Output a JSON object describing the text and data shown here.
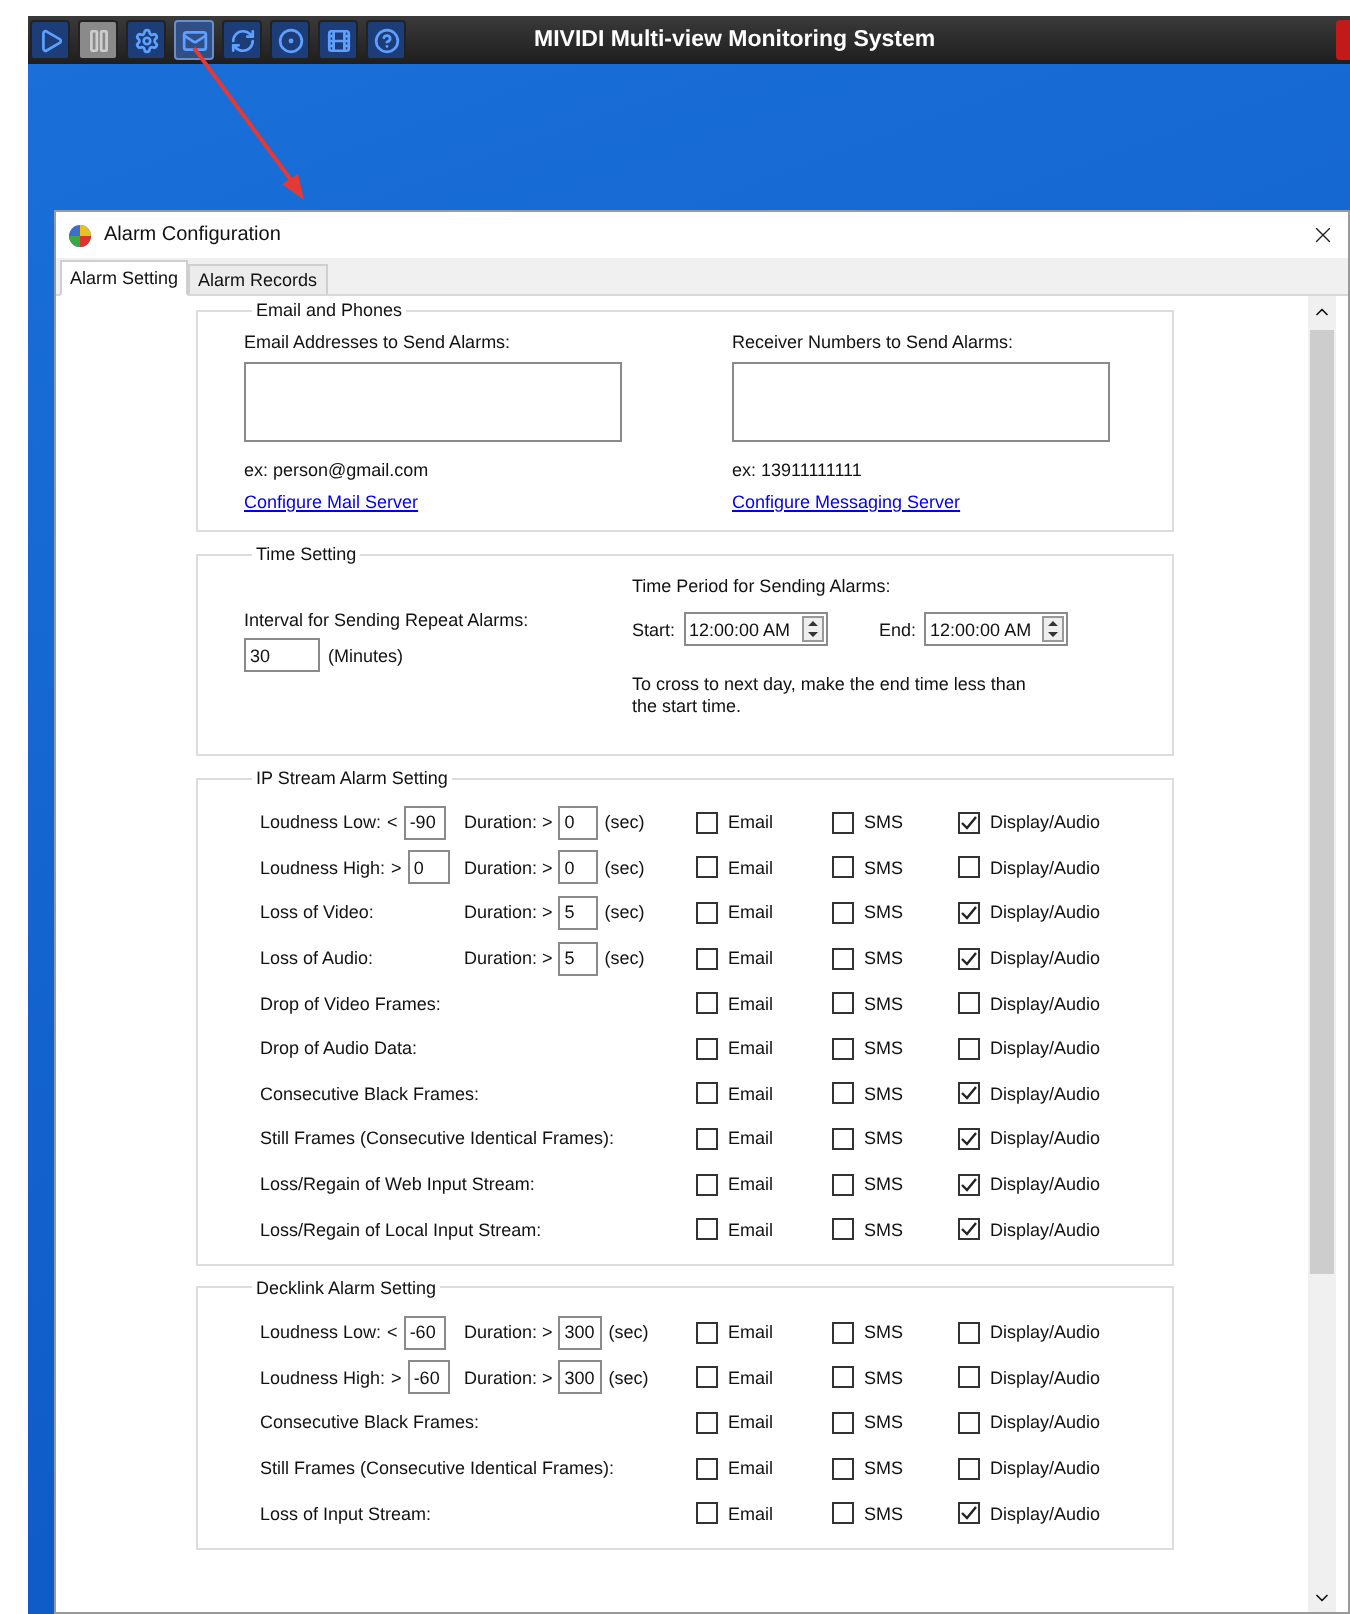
{
  "app": {
    "title": "MIVIDI Multi-view Monitoring System",
    "toolbar": [
      {
        "kind": "play",
        "disabled": false,
        "selected": false
      },
      {
        "kind": "pause",
        "disabled": true,
        "selected": false
      },
      {
        "kind": "settings",
        "disabled": false,
        "selected": false
      },
      {
        "kind": "mail",
        "disabled": false,
        "selected": true
      },
      {
        "kind": "refresh",
        "disabled": false,
        "selected": false
      },
      {
        "kind": "record",
        "disabled": false,
        "selected": false
      },
      {
        "kind": "filmstrip",
        "disabled": false,
        "selected": false
      },
      {
        "kind": "help",
        "disabled": false,
        "selected": false
      }
    ]
  },
  "dialog": {
    "title": "Alarm Configuration",
    "tabs": [
      {
        "label": "Alarm Setting",
        "selected": true
      },
      {
        "label": "Alarm Records",
        "selected": false
      }
    ]
  },
  "email_and_phones": {
    "title": "Email and Phones",
    "columns": [
      {
        "label": "Email Addresses to Send Alarms:",
        "example": "ex: person@gmail.com",
        "link": "Configure Mail Server"
      },
      {
        "label": "Receiver Numbers to Send Alarms:",
        "example": "ex: 13911111111",
        "link": "Configure Messaging Server"
      }
    ]
  },
  "time_setting": {
    "title": "Time Setting",
    "interval_label": "Interval for Sending Repeat Alarms:",
    "interval_value": "30",
    "interval_unit": "(Minutes)",
    "period_label": "Time Period for Sending Alarms:",
    "start_label": "Start:",
    "start": "12:00:00 AM",
    "end_label": "End:",
    "end": "12:00:00 AM",
    "note": "To cross to next day, make the end time less than the start time."
  },
  "ip_stream": {
    "title": "IP Stream Alarm Setting",
    "rows": [
      {
        "kind": "threshold",
        "label": "Loudness Low:",
        "operator": "<",
        "value": "-90",
        "duration_label": "Duration: >",
        "duration": "0",
        "unit": "(sec)",
        "options": [
          {
            "label": "Email",
            "checked": false
          },
          {
            "label": "SMS",
            "checked": false
          },
          {
            "label": "Display/Audio",
            "checked": true
          }
        ]
      },
      {
        "kind": "threshold",
        "label": "Loudness High:",
        "operator": ">",
        "value": "0",
        "duration_label": "Duration: >",
        "duration": "0",
        "unit": "(sec)",
        "options": [
          {
            "label": "Email",
            "checked": false
          },
          {
            "label": "SMS",
            "checked": false
          },
          {
            "label": "Display/Audio",
            "checked": false
          }
        ]
      },
      {
        "kind": "duration",
        "label": "Loss of Video:",
        "duration_label": "Duration: >",
        "duration": "5",
        "unit": "(sec)",
        "options": [
          {
            "label": "Email",
            "checked": false
          },
          {
            "label": "SMS",
            "checked": false
          },
          {
            "label": "Display/Audio",
            "checked": true
          }
        ]
      },
      {
        "kind": "duration",
        "label": "Loss of Audio:",
        "duration_label": "Duration: >",
        "duration": "5",
        "unit": "(sec)",
        "options": [
          {
            "label": "Email",
            "checked": false
          },
          {
            "label": "SMS",
            "checked": false
          },
          {
            "label": "Display/Audio",
            "checked": true
          }
        ]
      },
      {
        "kind": "plain",
        "label": "Drop of Video Frames:",
        "options": [
          {
            "label": "Email",
            "checked": false
          },
          {
            "label": "SMS",
            "checked": false
          },
          {
            "label": "Display/Audio",
            "checked": false
          }
        ]
      },
      {
        "kind": "plain",
        "label": "Drop of Audio Data:",
        "options": [
          {
            "label": "Email",
            "checked": false
          },
          {
            "label": "SMS",
            "checked": false
          },
          {
            "label": "Display/Audio",
            "checked": false
          }
        ]
      },
      {
        "kind": "plain",
        "label": "Consecutive Black Frames:",
        "options": [
          {
            "label": "Email",
            "checked": false
          },
          {
            "label": "SMS",
            "checked": false
          },
          {
            "label": "Display/Audio",
            "checked": true
          }
        ]
      },
      {
        "kind": "plain",
        "label": "Still Frames (Consecutive Identical Frames):",
        "options": [
          {
            "label": "Email",
            "checked": false
          },
          {
            "label": "SMS",
            "checked": false
          },
          {
            "label": "Display/Audio",
            "checked": true
          }
        ]
      },
      {
        "kind": "plain",
        "label": "Loss/Regain of Web Input Stream:",
        "options": [
          {
            "label": "Email",
            "checked": false
          },
          {
            "label": "SMS",
            "checked": false
          },
          {
            "label": "Display/Audio",
            "checked": true
          }
        ]
      },
      {
        "kind": "plain",
        "label": "Loss/Regain of Local Input Stream:",
        "options": [
          {
            "label": "Email",
            "checked": false
          },
          {
            "label": "SMS",
            "checked": false
          },
          {
            "label": "Display/Audio",
            "checked": true
          }
        ]
      }
    ]
  },
  "decklink": {
    "title": "Decklink Alarm Setting",
    "rows": [
      {
        "kind": "threshold",
        "label": "Loudness Low:",
        "operator": "<",
        "value": "-60",
        "duration_label": "Duration: >",
        "duration": "300",
        "unit": "(sec)",
        "options": [
          {
            "label": "Email",
            "checked": false
          },
          {
            "label": "SMS",
            "checked": false
          },
          {
            "label": "Display/Audio",
            "checked": false
          }
        ]
      },
      {
        "kind": "threshold",
        "label": "Loudness High:",
        "operator": ">",
        "value": "-60",
        "duration_label": "Duration: >",
        "duration": "300",
        "unit": "(sec)",
        "options": [
          {
            "label": "Email",
            "checked": false
          },
          {
            "label": "SMS",
            "checked": false
          },
          {
            "label": "Display/Audio",
            "checked": false
          }
        ]
      },
      {
        "kind": "plain",
        "label": "Consecutive Black Frames:",
        "options": [
          {
            "label": "Email",
            "checked": false
          },
          {
            "label": "SMS",
            "checked": false
          },
          {
            "label": "Display/Audio",
            "checked": false
          }
        ]
      },
      {
        "kind": "plain",
        "label": "Still Frames (Consecutive Identical Frames):",
        "options": [
          {
            "label": "Email",
            "checked": false
          },
          {
            "label": "SMS",
            "checked": false
          },
          {
            "label": "Display/Audio",
            "checked": false
          }
        ]
      },
      {
        "kind": "plain",
        "label": "Loss of Input Stream:",
        "options": [
          {
            "label": "Email",
            "checked": false
          },
          {
            "label": "SMS",
            "checked": false
          },
          {
            "label": "Display/Audio",
            "checked": true
          }
        ]
      }
    ]
  }
}
